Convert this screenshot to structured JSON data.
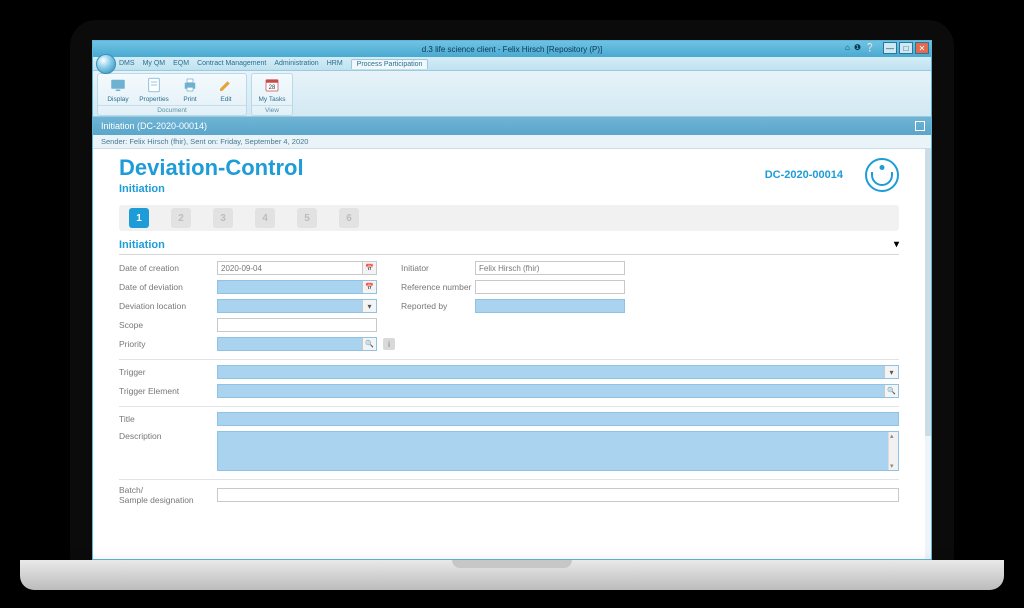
{
  "window": {
    "title": "d.3 life science client - Felix Hirsch [Repository (P)]"
  },
  "menubar": {
    "items": [
      "DMS",
      "My QM",
      "EQM",
      "Contract Management",
      "Administration",
      "HRM",
      "Process Participation"
    ],
    "active_index": 6
  },
  "ribbon": {
    "group_document": {
      "label": "Document",
      "buttons": {
        "display": "Display",
        "properties": "Properties",
        "print": "Print",
        "edit": "Edit"
      }
    },
    "group_view": {
      "label": "View",
      "buttons": {
        "my_tasks": "My Tasks"
      }
    }
  },
  "docbar": {
    "title": "Initiation (DC-2020-00014)"
  },
  "infobar": {
    "text": "Sender: Felix Hirsch (fhir), Sent on: Friday, September 4, 2020"
  },
  "header": {
    "title": "Deviation-Control",
    "subtitle": "Initiation",
    "doc_number": "DC-2020-00014"
  },
  "steps": [
    "1",
    "2",
    "3",
    "4",
    "5",
    "6"
  ],
  "section_title": "Initiation",
  "labels": {
    "date_of_creation": "Date of creation",
    "date_of_deviation": "Date of deviation",
    "deviation_location": "Deviation location",
    "scope": "Scope",
    "priority": "Priority",
    "initiator": "Initiator",
    "reference_number": "Reference number",
    "reported_by": "Reported by",
    "trigger": "Trigger",
    "trigger_element": "Trigger Element",
    "title": "Title",
    "description": "Description",
    "batch": "Batch/\nSample designation"
  },
  "values": {
    "date_of_creation": "2020-09-04",
    "initiator": "Felix Hirsch (fhir)"
  }
}
